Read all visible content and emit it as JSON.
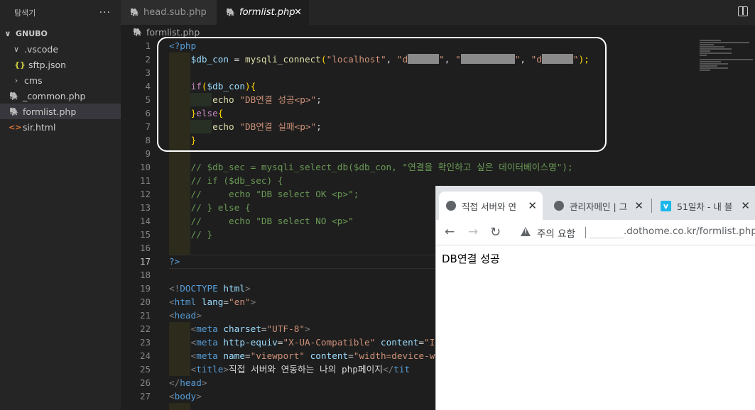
{
  "explorer": {
    "title": "탐색기",
    "more": "···",
    "root": "GNUBO",
    "items": [
      {
        "label": ".vscode",
        "kind": "folder-open"
      },
      {
        "label": "sftp.json",
        "kind": "json",
        "icon": "{}"
      },
      {
        "label": "cms",
        "kind": "folder-closed"
      },
      {
        "label": "_common.php",
        "kind": "php"
      },
      {
        "label": "formlist.php",
        "kind": "php",
        "selected": true
      },
      {
        "label": "sir.html",
        "kind": "html",
        "icon": "<>"
      }
    ]
  },
  "tabs": [
    {
      "label": "head.sub.php",
      "active": false
    },
    {
      "label": "formlist.php",
      "active": true,
      "close": "✕"
    }
  ],
  "breadcrumb": "formlist.php",
  "current_line": 17,
  "code": {
    "l1": "<?php",
    "l2_var": "$db_con",
    "l2_eq": " = ",
    "l2_fn": "mysqli_connect",
    "l2_p": "(",
    "l2_s1": "\"localhost\"",
    "l2_c": ", ",
    "l2_s2a": "\"d",
    "l2_s2b": "\"",
    "l2_s3a": "\"",
    "l2_s3b": "\"",
    "l2_s4a": "\"d",
    "l2_s4b": "\"",
    "l2_end": ");",
    "l4_if": "if",
    "l4_p": "(",
    "l4_var": "$db_con",
    "l4_e": "){",
    "l5_echo": "echo",
    "l5_s": "\"DB연결 성공<p>\"",
    "l5_e": ";",
    "l6_b": "}",
    "l6_else": "else",
    "l6_ob": "{",
    "l7_echo": "echo",
    "l7_s": "\"DB연결 실패<p>\"",
    "l7_e": ";",
    "l8_b": "}",
    "l10": "// $db_sec = mysqli_select_db($db_con, \"연결을 확인하고 싶은 데이터베이스명\");",
    "l11": "// if ($db_sec) {",
    "l12": "//     echo \"DB select OK <p>\";",
    "l13": "// } else {",
    "l14": "//     echo \"DB select NO <p>\"",
    "l15": "// }",
    "l17": "?>",
    "l19_a": "<!",
    "l19_b": "DOCTYPE",
    "l19_c": " html",
    "l19_d": ">",
    "l20_a": "<",
    "l20_b": "html",
    "l20_c": " lang",
    "l20_d": "=",
    "l20_e": "\"en\"",
    "l20_f": ">",
    "l21_a": "<",
    "l21_b": "head",
    "l21_c": ">",
    "l22_a": "<",
    "l22_b": "meta",
    "l22_c": " charset",
    "l22_d": "=",
    "l22_e": "\"UTF-8\"",
    "l22_f": ">",
    "l23_a": "<",
    "l23_b": "meta",
    "l23_c": " http-equiv",
    "l23_d": "=",
    "l23_e": "\"X-UA-Compatible\"",
    "l23_f": " content",
    "l23_g": "=",
    "l23_h": "\"I",
    "l24_a": "<",
    "l24_b": "meta",
    "l24_c": " name",
    "l24_d": "=",
    "l24_e": "\"viewport\"",
    "l24_f": " content",
    "l24_g": "=",
    "l24_h": "\"width=device-w",
    "l25_a": "<",
    "l25_b": "title",
    "l25_c": ">",
    "l25_d": "직접 서버와 연동하는 나의 php페이지",
    "l25_e": "</",
    "l25_f": "tit",
    "l26_a": "</",
    "l26_b": "head",
    "l26_c": ">",
    "l27_a": "<",
    "l27_b": "body",
    "l27_c": ">"
  },
  "browser": {
    "tabs": [
      {
        "label": "직접 서버와 연",
        "active": true
      },
      {
        "label": "관리자메인 | 그",
        "active": false
      },
      {
        "label": "51일차 - 내 블",
        "active": false,
        "icon": "v"
      }
    ],
    "tab_close": "✕",
    "warning": "주의 요함",
    "url": ".dothome.co.kr/formlist.php",
    "content": "DB연결 성공"
  }
}
